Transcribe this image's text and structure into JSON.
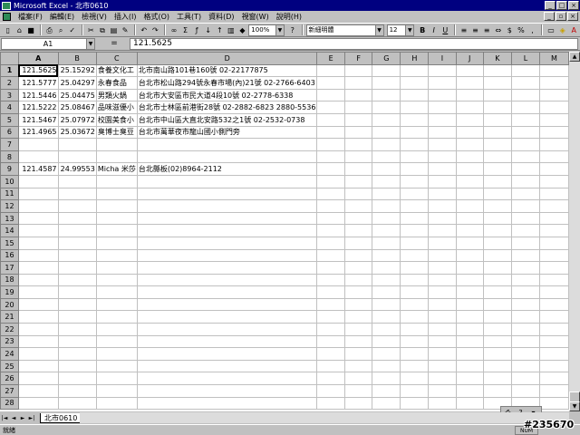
{
  "window": {
    "title": "Microsoft Excel - 北市0610"
  },
  "menu": [
    "檔案(F)",
    "編輯(E)",
    "檢視(V)",
    "插入(I)",
    "格式(O)",
    "工具(T)",
    "資料(D)",
    "視窗(W)",
    "說明(H)"
  ],
  "toolbar": {
    "zoom": "100%",
    "font_name": "新細明體",
    "font_size": "12"
  },
  "formula_bar": {
    "cell_ref": "A1",
    "equals": "=",
    "value": "121.5625"
  },
  "columns": [
    "A",
    "B",
    "C",
    "D",
    "E",
    "F",
    "G",
    "H",
    "I",
    "J",
    "K",
    "L",
    "M"
  ],
  "row_count": 28,
  "cells": {
    "1": [
      "121.5625",
      "25.15292",
      "食養文化工",
      "北市南山路101巷160號  02-22177875"
    ],
    "2": [
      "121.5777",
      "25.04297",
      "永春食品",
      "台北市松山路294號永春市場(內)21號 02-2766-6403"
    ],
    "3": [
      "121.5446",
      "25.04475",
      "男類火鍋",
      "台北市大安區市民大道4段10號 02-2778-6338"
    ],
    "4": [
      "121.5222",
      "25.08467",
      "品味滋優小",
      "台北市士林區前港街28號 02-2882-6823  2880-5536"
    ],
    "5": [
      "121.5467",
      "25.07972",
      "校園美食小",
      "台北市中山區大直北安路532之1號 02-2532-0738"
    ],
    "6": [
      "121.4965",
      "25.03672",
      "臭博士臭豆",
      "台北市萬華夜市龍山國小側門旁"
    ],
    "9": [
      "121.4587",
      "24.99553",
      "Micha 米莎",
      "台北縣板(02)8964-2112"
    ]
  },
  "sheet_tab": "北市0610",
  "status": {
    "ready": "就緒",
    "num": "NUM"
  },
  "watermark": "#235670"
}
